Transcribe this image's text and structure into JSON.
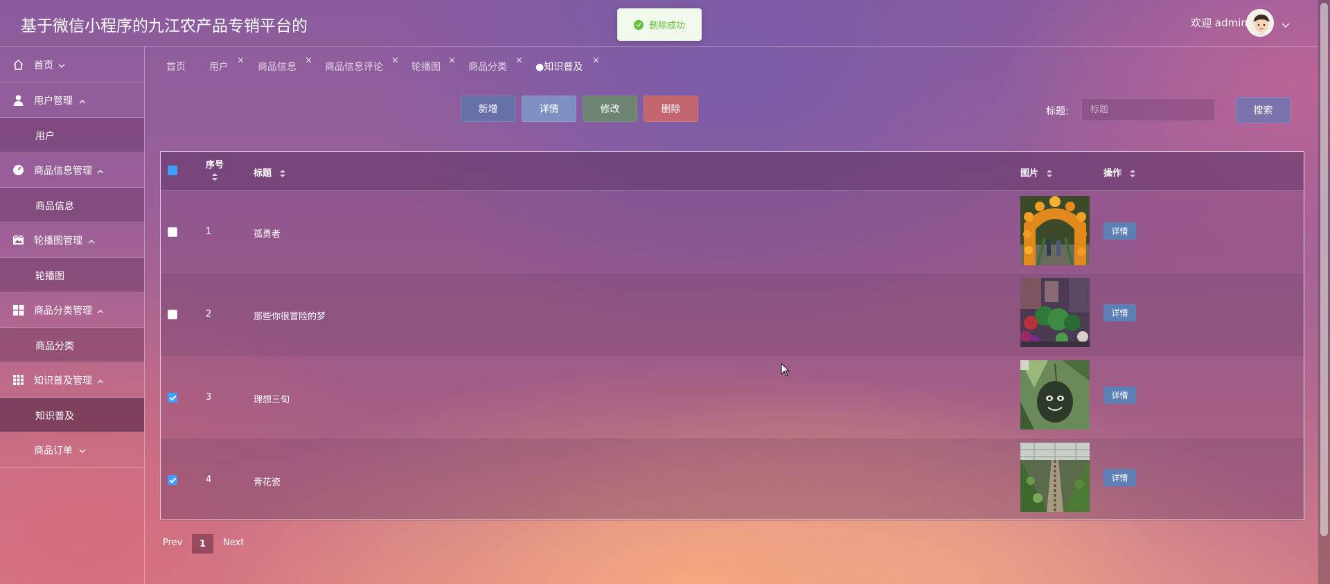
{
  "header": {
    "title": "基于微信小程序的九江农产品专销平台的",
    "toast": "删除成功",
    "welcome": "欢迎 admin"
  },
  "sidebar": {
    "items": [
      {
        "label": "首页",
        "icon": "home-icon"
      },
      {
        "label": "用户管理",
        "icon": "user-icon",
        "sub": "用户"
      },
      {
        "label": "商品信息管理",
        "icon": "dashboard-icon",
        "sub": "商品信息"
      },
      {
        "label": "轮播图管理",
        "icon": "picture-icon",
        "sub": "轮播图"
      },
      {
        "label": "商品分类管理",
        "icon": "grid-icon",
        "sub": "商品分类"
      },
      {
        "label": "知识普及管理",
        "icon": "apps-icon",
        "sub": "知识普及"
      },
      {
        "label": "商品订单"
      }
    ]
  },
  "tabs": [
    "首页",
    "用户",
    "商品信息",
    "商品信息评论",
    "轮播图",
    "商品分类",
    "知识普及"
  ],
  "toolbar": {
    "add": "新增",
    "detail": "详情",
    "edit": "修改",
    "delete": "删除",
    "search_label": "标题:",
    "search_placeholder": "标题",
    "search_button": "搜索"
  },
  "table": {
    "columns": [
      "序号",
      "标题",
      "图片",
      "操作"
    ],
    "rows": [
      {
        "index": "1",
        "title": "孤勇者",
        "checked": false,
        "action": "详情"
      },
      {
        "index": "2",
        "title": "那些你很冒险的梦",
        "checked": false,
        "action": "详情"
      },
      {
        "index": "3",
        "title": "理想三旬",
        "checked": true,
        "action": "详情"
      },
      {
        "index": "4",
        "title": "青花瓷",
        "checked": true,
        "action": "详情"
      }
    ]
  },
  "pagination": {
    "prev": "Prev",
    "page": "1",
    "next": "Next"
  },
  "colors": {
    "primary": "#409eff",
    "success": "#67c23a",
    "danger": "#c2656f"
  }
}
